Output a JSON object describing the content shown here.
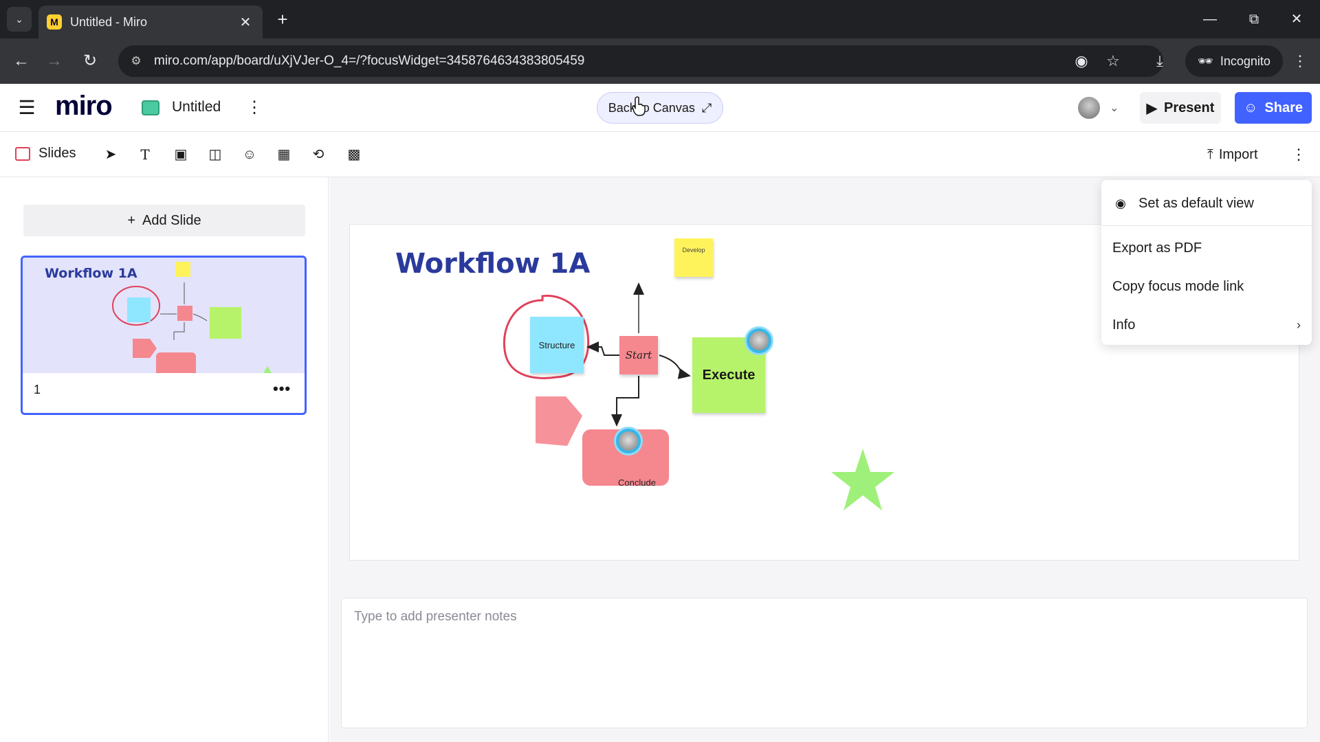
{
  "browser": {
    "tab_title": "Untitled - Miro",
    "tab_favicon": "M",
    "url": "miro.com/app/board/uXjVJer-O_4=/?focusWidget=3458764634383805459",
    "incognito_label": "Incognito"
  },
  "topbar": {
    "logo": "miro",
    "board_title": "Untitled",
    "back_to_canvas": "Back to Canvas",
    "present_label": "Present",
    "share_label": "Share"
  },
  "toolbar": {
    "slides_label": "Slides",
    "import_label": "Import"
  },
  "slides_panel": {
    "add_slide_label": "Add Slide",
    "slides": [
      {
        "number": "1",
        "title": "Workflow 1A"
      }
    ]
  },
  "slide": {
    "title": "Workflow 1A",
    "stickies": {
      "develop": "Develop",
      "structure": "Structure",
      "start": "Start",
      "execute": "Execute",
      "conclude": "Conclude"
    }
  },
  "notes": {
    "placeholder": "Type to add presenter notes"
  },
  "menu": {
    "items": [
      {
        "label": "Set as default view",
        "icon": "focus-view-icon"
      },
      {
        "label": "Export as PDF"
      },
      {
        "label": "Copy focus mode link"
      },
      {
        "label": "Info",
        "has_submenu": true
      }
    ]
  },
  "colors": {
    "accent": "#4262ff",
    "title_blue": "#2a3a9c",
    "sticky_yellow": "#fff35c",
    "sticky_cyan": "#8fe6ff",
    "sticky_pink": "#f5878f",
    "sticky_green": "#b7f36a",
    "star_green": "#9ef07a",
    "outline_red": "#e0415a"
  }
}
